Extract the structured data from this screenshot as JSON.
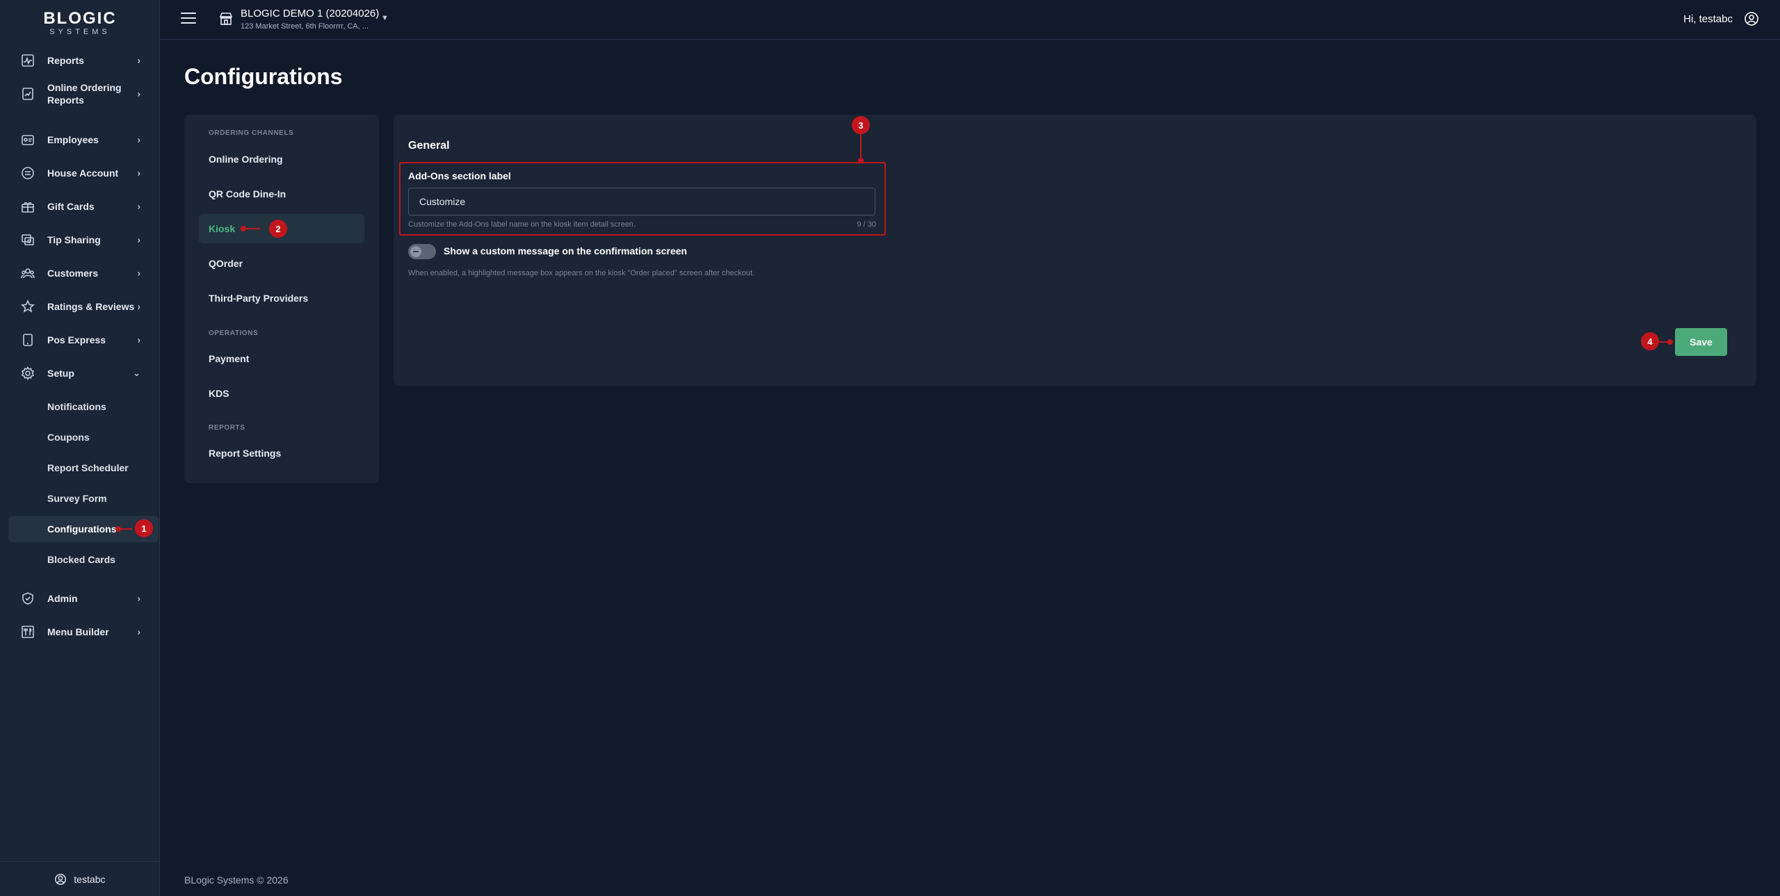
{
  "brand": {
    "name": "BLOGIC",
    "tagline": "SYSTEMS"
  },
  "sidebar": {
    "items": [
      {
        "label": "Reports",
        "icon": "activity-chart-icon"
      },
      {
        "label": "Online Ordering Reports",
        "icon": "trend-report-icon"
      },
      {
        "label": "Employees",
        "icon": "id-card-icon"
      },
      {
        "label": "House Account",
        "icon": "house-account-icon"
      },
      {
        "label": "Gift Cards",
        "icon": "gift-icon"
      },
      {
        "label": "Tip Sharing",
        "icon": "tip-sharing-icon"
      },
      {
        "label": "Customers",
        "icon": "users-icon"
      },
      {
        "label": "Ratings & Reviews",
        "icon": "star-icon"
      },
      {
        "label": "Pos Express",
        "icon": "tablet-icon"
      },
      {
        "label": "Setup",
        "icon": "gear-icon"
      },
      {
        "label": "Admin",
        "icon": "shield-icon"
      },
      {
        "label": "Menu Builder",
        "icon": "menu-builder-icon"
      }
    ],
    "setup_children": [
      {
        "label": "Notifications"
      },
      {
        "label": "Coupons"
      },
      {
        "label": "Report Scheduler"
      },
      {
        "label": "Survey Form"
      },
      {
        "label": "Configurations",
        "active": true
      },
      {
        "label": "Blocked Cards"
      }
    ],
    "footer_user": "testabc"
  },
  "header": {
    "store_name": "BLOGIC DEMO 1 (20204026)",
    "store_address": "123 Market Street, 6th Floorrrr, CA, ...",
    "greeting": "Hi, testabc"
  },
  "page": {
    "title": "Configurations"
  },
  "config_menu": {
    "sections": [
      {
        "header": "ORDERING CHANNELS",
        "items": [
          "Online Ordering",
          "QR Code Dine-In",
          "Kiosk",
          "QOrder",
          "Third-Party Providers"
        ]
      },
      {
        "header": "OPERATIONS",
        "items": [
          "Payment",
          "KDS"
        ]
      },
      {
        "header": "REPORTS",
        "items": [
          "Report Settings"
        ]
      }
    ],
    "active_item": "Kiosk"
  },
  "general": {
    "title": "General",
    "addons_label": "Add-Ons section label",
    "addons_value": "Customize",
    "addons_help": "Customize the Add-Ons label name on the kiosk item detail screen.",
    "char_count": "9 / 30",
    "toggle_label": "Show a custom message on the confirmation screen",
    "toggle_enabled": false,
    "toggle_help": "When enabled, a highlighted message box appears on the kiosk \"Order placed\" screen after checkout.",
    "save_label": "Save"
  },
  "callouts": [
    "1",
    "2",
    "3",
    "4"
  ],
  "colors": {
    "background": "#111a2b",
    "sidebar": "#1a2535",
    "panel": "#1b2535",
    "accent_green": "#4caa7a",
    "callout_red": "#c3161c"
  },
  "footer": {
    "copyright": "BLogic Systems © 2026"
  }
}
